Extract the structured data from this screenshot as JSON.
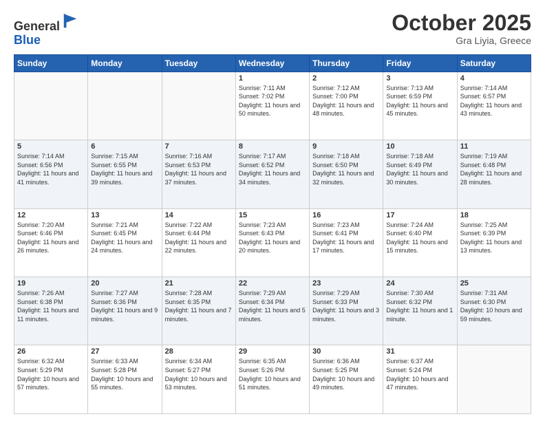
{
  "header": {
    "logo_line1": "General",
    "logo_line2": "Blue",
    "month": "October 2025",
    "location": "Gra Liyia, Greece"
  },
  "days_of_week": [
    "Sunday",
    "Monday",
    "Tuesday",
    "Wednesday",
    "Thursday",
    "Friday",
    "Saturday"
  ],
  "weeks": [
    [
      {
        "day": "",
        "info": ""
      },
      {
        "day": "",
        "info": ""
      },
      {
        "day": "",
        "info": ""
      },
      {
        "day": "1",
        "info": "Sunrise: 7:11 AM\nSunset: 7:02 PM\nDaylight: 11 hours\nand 50 minutes."
      },
      {
        "day": "2",
        "info": "Sunrise: 7:12 AM\nSunset: 7:00 PM\nDaylight: 11 hours\nand 48 minutes."
      },
      {
        "day": "3",
        "info": "Sunrise: 7:13 AM\nSunset: 6:59 PM\nDaylight: 11 hours\nand 45 minutes."
      },
      {
        "day": "4",
        "info": "Sunrise: 7:14 AM\nSunset: 6:57 PM\nDaylight: 11 hours\nand 43 minutes."
      }
    ],
    [
      {
        "day": "5",
        "info": "Sunrise: 7:14 AM\nSunset: 6:56 PM\nDaylight: 11 hours\nand 41 minutes."
      },
      {
        "day": "6",
        "info": "Sunrise: 7:15 AM\nSunset: 6:55 PM\nDaylight: 11 hours\nand 39 minutes."
      },
      {
        "day": "7",
        "info": "Sunrise: 7:16 AM\nSunset: 6:53 PM\nDaylight: 11 hours\nand 37 minutes."
      },
      {
        "day": "8",
        "info": "Sunrise: 7:17 AM\nSunset: 6:52 PM\nDaylight: 11 hours\nand 34 minutes."
      },
      {
        "day": "9",
        "info": "Sunrise: 7:18 AM\nSunset: 6:50 PM\nDaylight: 11 hours\nand 32 minutes."
      },
      {
        "day": "10",
        "info": "Sunrise: 7:18 AM\nSunset: 6:49 PM\nDaylight: 11 hours\nand 30 minutes."
      },
      {
        "day": "11",
        "info": "Sunrise: 7:19 AM\nSunset: 6:48 PM\nDaylight: 11 hours\nand 28 minutes."
      }
    ],
    [
      {
        "day": "12",
        "info": "Sunrise: 7:20 AM\nSunset: 6:46 PM\nDaylight: 11 hours\nand 26 minutes."
      },
      {
        "day": "13",
        "info": "Sunrise: 7:21 AM\nSunset: 6:45 PM\nDaylight: 11 hours\nand 24 minutes."
      },
      {
        "day": "14",
        "info": "Sunrise: 7:22 AM\nSunset: 6:44 PM\nDaylight: 11 hours\nand 22 minutes."
      },
      {
        "day": "15",
        "info": "Sunrise: 7:23 AM\nSunset: 6:43 PM\nDaylight: 11 hours\nand 20 minutes."
      },
      {
        "day": "16",
        "info": "Sunrise: 7:23 AM\nSunset: 6:41 PM\nDaylight: 11 hours\nand 17 minutes."
      },
      {
        "day": "17",
        "info": "Sunrise: 7:24 AM\nSunset: 6:40 PM\nDaylight: 11 hours\nand 15 minutes."
      },
      {
        "day": "18",
        "info": "Sunrise: 7:25 AM\nSunset: 6:39 PM\nDaylight: 11 hours\nand 13 minutes."
      }
    ],
    [
      {
        "day": "19",
        "info": "Sunrise: 7:26 AM\nSunset: 6:38 PM\nDaylight: 11 hours\nand 11 minutes."
      },
      {
        "day": "20",
        "info": "Sunrise: 7:27 AM\nSunset: 6:36 PM\nDaylight: 11 hours\nand 9 minutes."
      },
      {
        "day": "21",
        "info": "Sunrise: 7:28 AM\nSunset: 6:35 PM\nDaylight: 11 hours\nand 7 minutes."
      },
      {
        "day": "22",
        "info": "Sunrise: 7:29 AM\nSunset: 6:34 PM\nDaylight: 11 hours\nand 5 minutes."
      },
      {
        "day": "23",
        "info": "Sunrise: 7:29 AM\nSunset: 6:33 PM\nDaylight: 11 hours\nand 3 minutes."
      },
      {
        "day": "24",
        "info": "Sunrise: 7:30 AM\nSunset: 6:32 PM\nDaylight: 11 hours\nand 1 minute."
      },
      {
        "day": "25",
        "info": "Sunrise: 7:31 AM\nSunset: 6:30 PM\nDaylight: 10 hours\nand 59 minutes."
      }
    ],
    [
      {
        "day": "26",
        "info": "Sunrise: 6:32 AM\nSunset: 5:29 PM\nDaylight: 10 hours\nand 57 minutes."
      },
      {
        "day": "27",
        "info": "Sunrise: 6:33 AM\nSunset: 5:28 PM\nDaylight: 10 hours\nand 55 minutes."
      },
      {
        "day": "28",
        "info": "Sunrise: 6:34 AM\nSunset: 5:27 PM\nDaylight: 10 hours\nand 53 minutes."
      },
      {
        "day": "29",
        "info": "Sunrise: 6:35 AM\nSunset: 5:26 PM\nDaylight: 10 hours\nand 51 minutes."
      },
      {
        "day": "30",
        "info": "Sunrise: 6:36 AM\nSunset: 5:25 PM\nDaylight: 10 hours\nand 49 minutes."
      },
      {
        "day": "31",
        "info": "Sunrise: 6:37 AM\nSunset: 5:24 PM\nDaylight: 10 hours\nand 47 minutes."
      },
      {
        "day": "",
        "info": ""
      }
    ]
  ]
}
